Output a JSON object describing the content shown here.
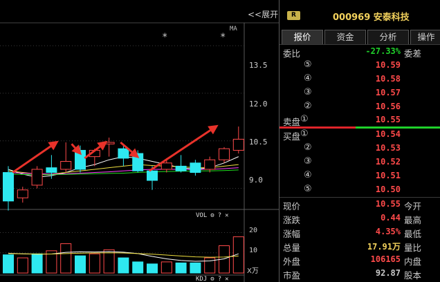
{
  "chart": {
    "expand_label": "<<展开",
    "ma_label": "MA",
    "star_mark": "*",
    "price_ticks": [
      "13.5",
      "12.0",
      "10.5",
      "9.0"
    ],
    "volume_panel": {
      "title": "VOL",
      "ticks": [
        "20",
        "10"
      ],
      "unit": "X万"
    },
    "kdj_panel": {
      "title": "KDJ"
    },
    "toolbar_glyphs": {
      "gear": "⚙",
      "help": "?",
      "close": "✕"
    },
    "colors": {
      "up": "#ff4a4a",
      "down": "#2ee8f0",
      "ma5": "#ffffff",
      "ma10": "#f0e040",
      "ma20": "#ff40ff",
      "ma30": "#20e020",
      "arrow": "#e8322a"
    }
  },
  "chart_data": {
    "type": "candlestick",
    "price_ylim": [
      8.4,
      14.2
    ],
    "candles": [
      {
        "o": 9.5,
        "h": 9.7,
        "l": 8.3,
        "c": 8.6
      },
      {
        "o": 8.7,
        "h": 9.05,
        "l": 8.55,
        "c": 8.95
      },
      {
        "o": 9.1,
        "h": 9.7,
        "l": 9.0,
        "c": 9.6
      },
      {
        "o": 9.65,
        "h": 10.05,
        "l": 9.3,
        "c": 9.5
      },
      {
        "o": 9.6,
        "h": 10.45,
        "l": 9.5,
        "c": 9.85
      },
      {
        "o": 10.2,
        "h": 10.35,
        "l": 9.5,
        "c": 9.6
      },
      {
        "o": 10.0,
        "h": 10.25,
        "l": 9.7,
        "c": 10.2
      },
      {
        "o": 10.4,
        "h": 10.6,
        "l": 10.0,
        "c": 10.45
      },
      {
        "o": 10.25,
        "h": 10.4,
        "l": 9.7,
        "c": 9.95
      },
      {
        "o": 10.1,
        "h": 10.2,
        "l": 9.5,
        "c": 9.55
      },
      {
        "o": 9.55,
        "h": 9.7,
        "l": 8.95,
        "c": 9.25
      },
      {
        "o": 9.6,
        "h": 9.95,
        "l": 9.5,
        "c": 9.8
      },
      {
        "o": 9.7,
        "h": 10.05,
        "l": 9.5,
        "c": 9.55
      },
      {
        "o": 9.8,
        "h": 9.9,
        "l": 9.4,
        "c": 9.5
      },
      {
        "o": 9.6,
        "h": 10.0,
        "l": 9.5,
        "c": 9.9
      },
      {
        "o": 9.9,
        "h": 10.3,
        "l": 9.8,
        "c": 10.25
      },
      {
        "o": 10.2,
        "h": 10.95,
        "l": 10.1,
        "c": 10.55
      }
    ],
    "ma_lines": [
      {
        "name": "MA5",
        "values": [
          9.6,
          9.45,
          9.35,
          9.4,
          9.5,
          9.65,
          9.75,
          9.9,
          10.0,
          9.95,
          9.85,
          9.75,
          9.65,
          9.6,
          9.65,
          9.8,
          10.0
        ]
      },
      {
        "name": "MA10",
        "values": [
          9.55,
          9.5,
          9.45,
          9.45,
          9.5,
          9.55,
          9.6,
          9.65,
          9.7,
          9.75,
          9.72,
          9.7,
          9.68,
          9.65,
          9.65,
          9.7,
          9.75
        ]
      },
      {
        "name": "MA20",
        "values": [
          9.5,
          9.48,
          9.46,
          9.45,
          9.46,
          9.48,
          9.5,
          9.52,
          9.55,
          9.58,
          9.6,
          9.6,
          9.6,
          9.6,
          9.6,
          9.62,
          9.65
        ]
      },
      {
        "name": "MA30",
        "values": [
          9.45,
          9.44,
          9.43,
          9.43,
          9.44,
          9.45,
          9.46,
          9.47,
          9.48,
          9.5,
          9.52,
          9.53,
          9.54,
          9.55,
          9.55,
          9.56,
          9.58
        ]
      }
    ],
    "volume_ylim": [
      0,
      27
    ],
    "volume": [
      {
        "v": 9,
        "up": false
      },
      {
        "v": 7.5,
        "up": true
      },
      {
        "v": 9.5,
        "up": false
      },
      {
        "v": 11,
        "up": true
      },
      {
        "v": 14.5,
        "up": true
      },
      {
        "v": 8.5,
        "up": false
      },
      {
        "v": 9.5,
        "up": true
      },
      {
        "v": 11.5,
        "up": true
      },
      {
        "v": 7.5,
        "up": false
      },
      {
        "v": 5.5,
        "up": false
      },
      {
        "v": 4.5,
        "up": false
      },
      {
        "v": 5.5,
        "up": true
      },
      {
        "v": 5.0,
        "up": false
      },
      {
        "v": 5.0,
        "up": false
      },
      {
        "v": 7.5,
        "up": true
      },
      {
        "v": 13.5,
        "up": true
      },
      {
        "v": 17.91,
        "up": true
      }
    ],
    "volume_ma": [
      {
        "name": "VOL-MA5",
        "values": [
          9.8,
          9.5,
          9.3,
          9.4,
          10.2,
          10.5,
          10.4,
          10.6,
          10.3,
          9.6,
          8.2,
          7.0,
          6.2,
          5.8,
          6.0,
          7.0,
          9.5
        ]
      },
      {
        "name": "VOL-MA10",
        "values": [
          9.6,
          9.5,
          9.4,
          9.4,
          9.6,
          9.8,
          9.9,
          10.0,
          9.9,
          9.6,
          9.3,
          8.9,
          8.4,
          8.0,
          7.8,
          7.9,
          8.4
        ]
      }
    ]
  },
  "panel": {
    "badge": "R",
    "title": "000969 安泰科技",
    "tabs": [
      "报价",
      "资金",
      "分析",
      "操作"
    ],
    "active_tab": 0,
    "weibi": {
      "label": "委比",
      "value": "-27.33%",
      "tail": "委差"
    },
    "sell_label": "卖盘",
    "buy_label": "买盘",
    "asks": [
      {
        "idx": "⑤",
        "price": "10.59"
      },
      {
        "idx": "④",
        "price": "10.58"
      },
      {
        "idx": "③",
        "price": "10.57"
      },
      {
        "idx": "②",
        "price": "10.56"
      },
      {
        "idx": "①",
        "price": "10.55"
      }
    ],
    "bids": [
      {
        "idx": "①",
        "price": "10.54"
      },
      {
        "idx": "②",
        "price": "10.53"
      },
      {
        "idx": "③",
        "price": "10.52"
      },
      {
        "idx": "④",
        "price": "10.51"
      },
      {
        "idx": "⑤",
        "price": "10.50"
      }
    ],
    "stats": [
      {
        "label": "现价",
        "value": "10.55",
        "tail": "今开",
        "color": "#ff4a4a"
      },
      {
        "label": "涨跌",
        "value": "0.44",
        "tail": "最高",
        "color": "#ff4a4a"
      },
      {
        "label": "涨幅",
        "value": "4.35%",
        "tail": "最低",
        "color": "#ff4a4a"
      },
      {
        "label": "总量",
        "value": "17.91万",
        "tail": "量比",
        "color": "#f2d15c"
      },
      {
        "label": "外盘",
        "value": "106165",
        "tail": "内盘",
        "color": "#ff4a4a"
      },
      {
        "label": "市盈",
        "value": "92.87",
        "tail": "股本",
        "color": "#c8c8c8"
      }
    ],
    "colors": {
      "up": "#ff4a4a",
      "down": "#1fd12a",
      "title": "#f2d15c"
    }
  }
}
